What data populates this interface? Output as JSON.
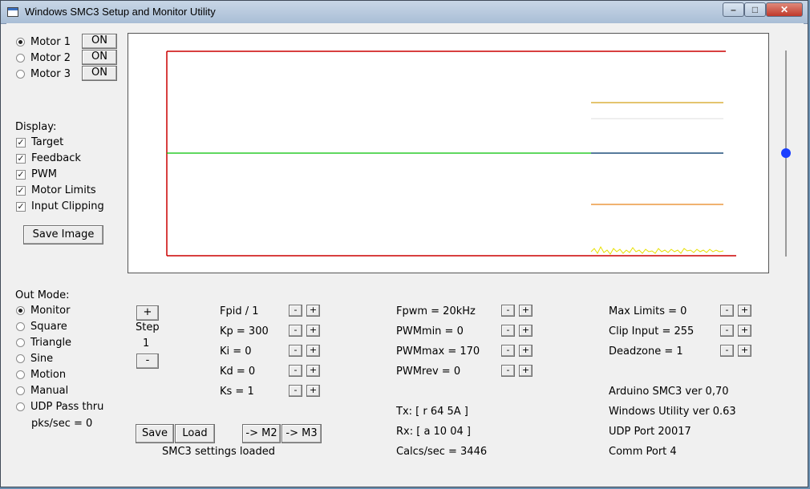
{
  "window": {
    "title": "Windows SMC3 Setup and Monitor Utility"
  },
  "motors": [
    {
      "label": "Motor 1",
      "selected": true,
      "button": "ON"
    },
    {
      "label": "Motor 2",
      "selected": false,
      "button": "ON"
    },
    {
      "label": "Motor 3",
      "selected": false,
      "button": "ON"
    }
  ],
  "display": {
    "heading": "Display:",
    "options": [
      {
        "label": "Target",
        "checked": true
      },
      {
        "label": "Feedback",
        "checked": true
      },
      {
        "label": "PWM",
        "checked": true
      },
      {
        "label": "Motor Limits",
        "checked": true
      },
      {
        "label": "Input Clipping",
        "checked": true
      }
    ],
    "save_image": "Save Image"
  },
  "out_mode": {
    "heading": "Out Mode:",
    "options": [
      {
        "label": "Monitor",
        "selected": true
      },
      {
        "label": "Square",
        "selected": false
      },
      {
        "label": "Triangle",
        "selected": false
      },
      {
        "label": "Sine",
        "selected": false
      },
      {
        "label": "Motion",
        "selected": false
      },
      {
        "label": "Manual",
        "selected": false
      },
      {
        "label": "UDP Pass thru",
        "selected": false
      }
    ],
    "pks": "pks/sec = 0"
  },
  "step": {
    "plus": "+",
    "label": "Step",
    "value": "1",
    "minus": "-"
  },
  "pid": [
    "Fpid / 1",
    "Kp = 300",
    "Ki = 0",
    "Kd = 0",
    "Ks = 1"
  ],
  "pwm": [
    "Fpwm = 20kHz",
    "PWMmin = 0",
    "PWMmax = 170",
    "PWMrev = 0"
  ],
  "limits": [
    "Max Limits = 0",
    "Clip Input = 255",
    "Deadzone = 1"
  ],
  "adjust": {
    "minus": "-",
    "plus": "+"
  },
  "buttons": {
    "save": "Save",
    "load": "Load",
    "to_m2": "-> M2",
    "to_m3": "-> M3"
  },
  "status": "SMC3 settings loaded",
  "comm": {
    "tx": "Tx: [ r 64 5A ]",
    "rx": "Rx: [ a 10 04 ]",
    "calcs": "Calcs/sec = 3446"
  },
  "info": [
    "Arduino SMC3 ver 0,70",
    "Windows Utility ver 0.63",
    "UDP Port 20017",
    "Comm Port 4"
  ],
  "slider": {
    "value": 0.5
  },
  "colors": {
    "limits_line": "#cc0000",
    "target_line": "#00c000",
    "feedback_line": "#1f4e7a",
    "pwm_line": "#e8e000",
    "clip_upper": "#d4a017",
    "clip_lower": "#e8841a",
    "slider_thumb": "#1a3fff"
  }
}
